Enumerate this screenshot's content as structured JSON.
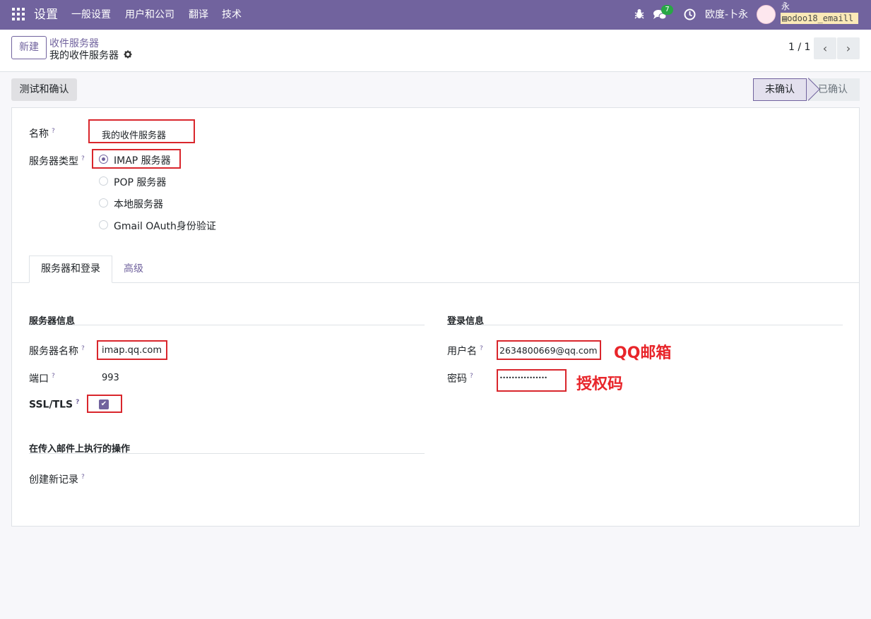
{
  "nav": {
    "app_title": "设置",
    "menu": [
      "一般设置",
      "用户和公司",
      "翻译",
      "技术"
    ],
    "message_count": "7",
    "company": "欧度-卜永",
    "user_name": "永",
    "database": "odoo18_emaill"
  },
  "control": {
    "new_label": "新建",
    "breadcrumb_parent": "收件服务器",
    "breadcrumb_current": "我的收件服务器",
    "pager": "1 / 1"
  },
  "status": {
    "test_button": "测试和确认",
    "stages": [
      "未确认",
      "已确认"
    ]
  },
  "form": {
    "name_label": "名称",
    "name_value": "我的收件服务器",
    "server_type_label": "服务器类型",
    "server_types": [
      "IMAP 服务器",
      "POP 服务器",
      "本地服务器",
      "Gmail OAuth身份验证"
    ],
    "tabs": [
      "服务器和登录",
      "高级"
    ],
    "server_info_title": "服务器信息",
    "server_name_label": "服务器名称",
    "server_name_value": "imap.qq.com",
    "port_label": "端口",
    "port_value": "993",
    "ssl_label": "SSL/TLS",
    "login_info_title": "登录信息",
    "username_label": "用户名",
    "username_value": "2634800669@qq.com",
    "password_label": "密码",
    "password_value": "••••••••••••••••",
    "actions_title": "在传入邮件上执行的操作",
    "create_record_label": "创建新记录"
  },
  "annotations": {
    "qq_mail": "QQ邮箱",
    "auth_code": "授权码"
  }
}
